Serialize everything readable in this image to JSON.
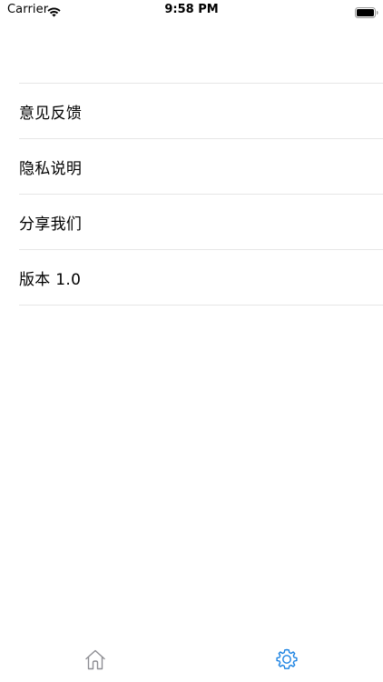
{
  "status_bar": {
    "carrier": "Carrier",
    "time": "9:58 PM",
    "wifi_icon": "wifi-icon",
    "battery_icon": "battery-full-icon"
  },
  "menu": {
    "items": [
      {
        "label": "意见反馈"
      },
      {
        "label": "隐私说明"
      },
      {
        "label": "分享我们"
      },
      {
        "label": "版本 1.0"
      }
    ]
  },
  "tab_bar": {
    "tabs": [
      {
        "icon": "home-icon",
        "selected": false,
        "color": "#8e8e93"
      },
      {
        "icon": "gear-icon",
        "selected": true,
        "color": "#1a82e2"
      }
    ]
  }
}
